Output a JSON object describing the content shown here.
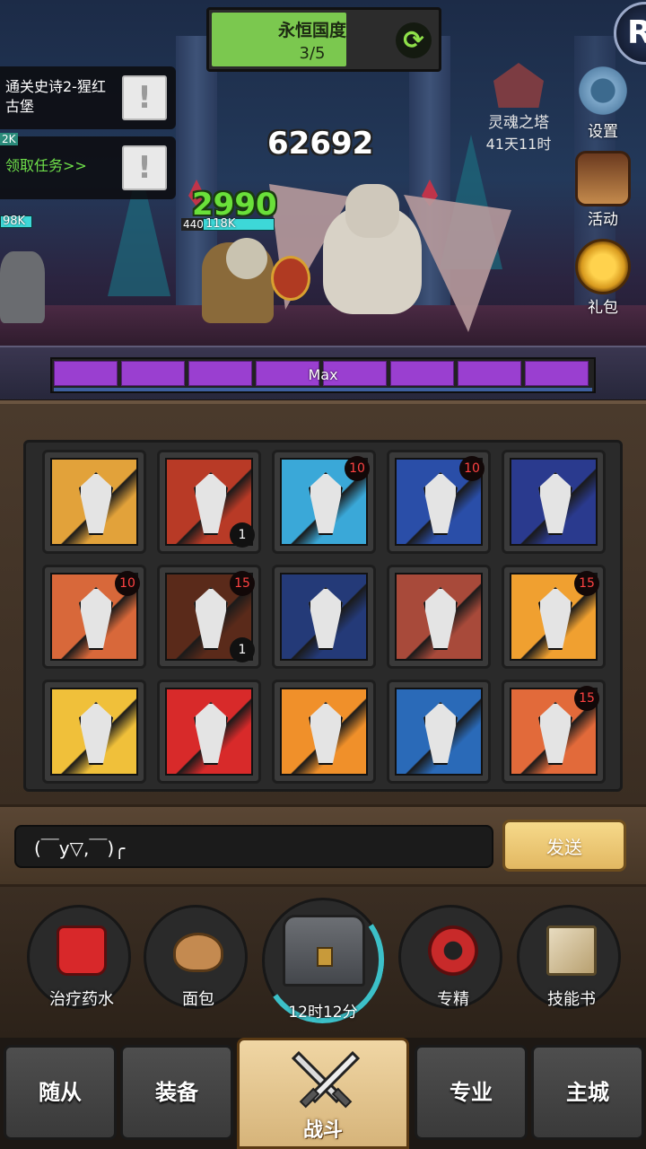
{
  "zone": {
    "name": "永恒国度",
    "progress": "3/5",
    "progress_fraction": 0.6
  },
  "tasks": [
    {
      "text": "通关史诗2-猩红古堡",
      "alert": "!"
    },
    {
      "text": "领取任务>>",
      "alert": "!"
    }
  ],
  "tower": {
    "name": "灵魂之塔",
    "time": "41天11时"
  },
  "side_menu": [
    {
      "label": "设置",
      "icon": "gear-icon"
    },
    {
      "label": "活动",
      "icon": "event-board-icon"
    },
    {
      "label": "礼包",
      "icon": "gift-coin-icon"
    }
  ],
  "combat": {
    "damage_white": "62692",
    "damage_green": "2990",
    "hero_level": "440",
    "hero_hp": "118K",
    "left_hp": "98K",
    "left_small": "2K"
  },
  "power_bar": {
    "label": "Max",
    "segments": 8
  },
  "skills": [
    {
      "icon": "serrated-sword-icon",
      "bg": "#e2a23a",
      "badge": "",
      "count": ""
    },
    {
      "icon": "flaming-blade-icon",
      "bg": "#b83a26",
      "badge": "",
      "count": "1"
    },
    {
      "icon": "triple-claw-icon",
      "bg": "#3aa8d8",
      "badge": "10",
      "count": ""
    },
    {
      "icon": "cracked-shield-icon",
      "bg": "#2a4ea8",
      "badge": "10",
      "count": ""
    },
    {
      "icon": "battle-axe-icon",
      "bg": "#2a3a8e",
      "badge": "",
      "count": ""
    },
    {
      "icon": "shield-bash-icon",
      "bg": "#d8683a",
      "badge": "10",
      "count": ""
    },
    {
      "icon": "fire-slash-icon",
      "bg": "#5a2a1a",
      "badge": "15",
      "count": "1"
    },
    {
      "icon": "greatsword-icon",
      "bg": "#243a78",
      "badge": "",
      "count": ""
    },
    {
      "icon": "broad-blade-icon",
      "bg": "#a84a3a",
      "badge": "",
      "count": ""
    },
    {
      "icon": "piercing-sword-icon",
      "bg": "#f0a030",
      "badge": "15",
      "count": ""
    },
    {
      "icon": "trident-claw-icon",
      "bg": "#f0c03a",
      "badge": "",
      "count": ""
    },
    {
      "icon": "demon-mask-icon",
      "bg": "#d82a2a",
      "badge": "",
      "count": ""
    },
    {
      "icon": "hexagon-shield-icon",
      "bg": "#f0902a",
      "badge": "",
      "count": ""
    },
    {
      "icon": "hammer-icon",
      "bg": "#2a6ab8",
      "badge": "",
      "count": ""
    },
    {
      "icon": "dagger-icon",
      "bg": "#e26a3a",
      "badge": "15",
      "count": ""
    }
  ],
  "chat": {
    "value": "(￣y▽,￣)╭",
    "send_label": "发送"
  },
  "quick_items": [
    {
      "label": "治疗药水",
      "icon": "potion-icon",
      "color": "#d8282a"
    },
    {
      "label": "面包",
      "icon": "bread-icon",
      "color": "#c48a50"
    },
    {
      "label": "专精",
      "icon": "mastery-icon",
      "color": "#c82a2a"
    },
    {
      "label": "技能书",
      "icon": "skill-book-icon",
      "color": "#d8c8a0"
    }
  ],
  "chest": {
    "time": "12时12分"
  },
  "nav": {
    "tabs": [
      "随从",
      "装备",
      "专业",
      "主城"
    ],
    "active": "战斗"
  }
}
